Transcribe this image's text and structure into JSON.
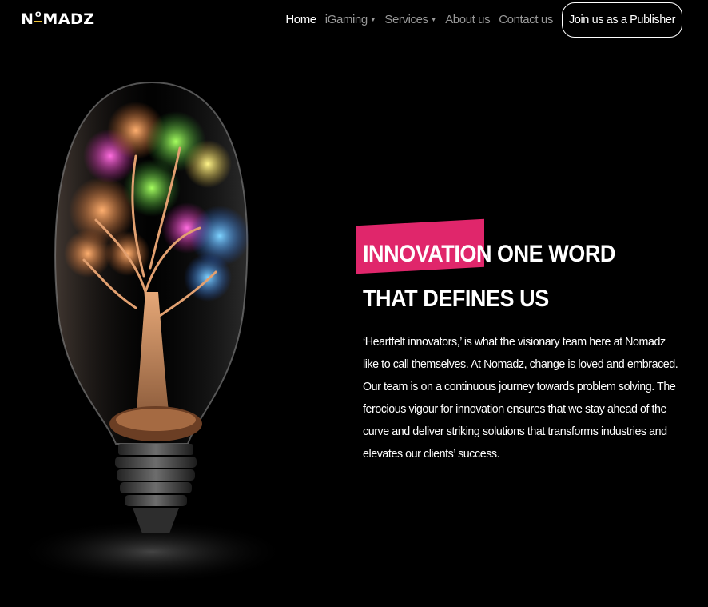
{
  "brand": {
    "logo_text_left": "N",
    "logo_text_o": "O",
    "logo_text_right": "MADZ",
    "accent": "#f0c437"
  },
  "nav": {
    "items": [
      {
        "label": "Home",
        "active": true,
        "has_dropdown": false
      },
      {
        "label": "iGaming",
        "active": false,
        "has_dropdown": true
      },
      {
        "label": "Services",
        "active": false,
        "has_dropdown": true
      },
      {
        "label": "About us",
        "active": false,
        "has_dropdown": false
      },
      {
        "label": "Contact us",
        "active": false,
        "has_dropdown": false
      }
    ],
    "cta_label": "Join us as a Publisher",
    "caret_icon": "caret-down-icon"
  },
  "hero": {
    "image": "lightbulb-tree-illustration",
    "headline_line1_highlight": "INNOVATION",
    "headline_line1_rest": " ONE WORD",
    "headline_line2": "THAT DEFINES US",
    "highlight_color": "#e0266b",
    "body": "‘Heartfelt innovators,’ is what the visionary team here at Nomadz like to call themselves. At Nomadz, change is loved and embraced. Our team is on a continuous journey towards problem solving. The ferocious vigour for innovation ensures that we stay ahead of the curve and deliver striking solutions that transforms industries and elevates our clients’ success."
  }
}
